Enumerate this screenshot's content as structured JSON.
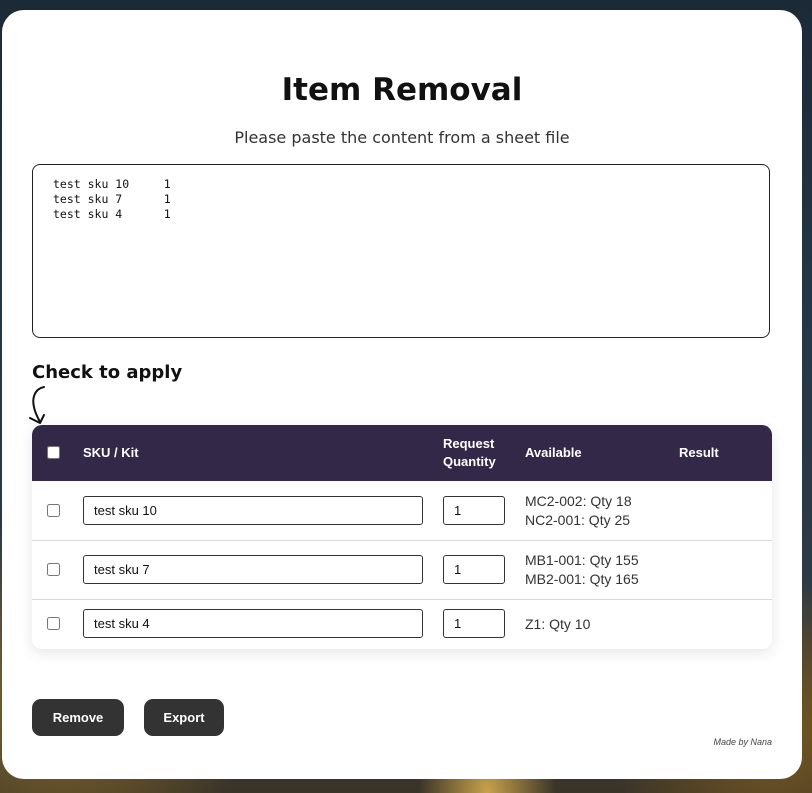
{
  "header": {
    "title": "Item Removal",
    "subtitle": "Please paste the content from a sheet file"
  },
  "paste_area": {
    "value": "test sku 10     1\ntest sku 7      1\ntest sku 4      1"
  },
  "check_label": "Check to apply",
  "table": {
    "columns": {
      "sku": "SKU / Kit",
      "request_quantity": "Request\nQuantity",
      "available": "Available",
      "result": "Result"
    },
    "rows": [
      {
        "sku": "test sku 10",
        "quantity": "1",
        "available": [
          "MC2-002: Qty 18",
          "NC2-001: Qty 25"
        ],
        "result": ""
      },
      {
        "sku": "test sku 7",
        "quantity": "1",
        "available": [
          "MB1-001: Qty 155",
          "MB2-001: Qty 165"
        ],
        "result": ""
      },
      {
        "sku": "test sku 4",
        "quantity": "1",
        "available": [
          "Z1: Qty 10"
        ],
        "result": ""
      }
    ]
  },
  "buttons": {
    "remove": "Remove",
    "export": "Export"
  },
  "credit": "Made by Nana",
  "colors": {
    "table_header": "#332847",
    "button": "#333333"
  },
  "icons": {
    "check_label_arrow": "curved-arrow-down-icon"
  }
}
